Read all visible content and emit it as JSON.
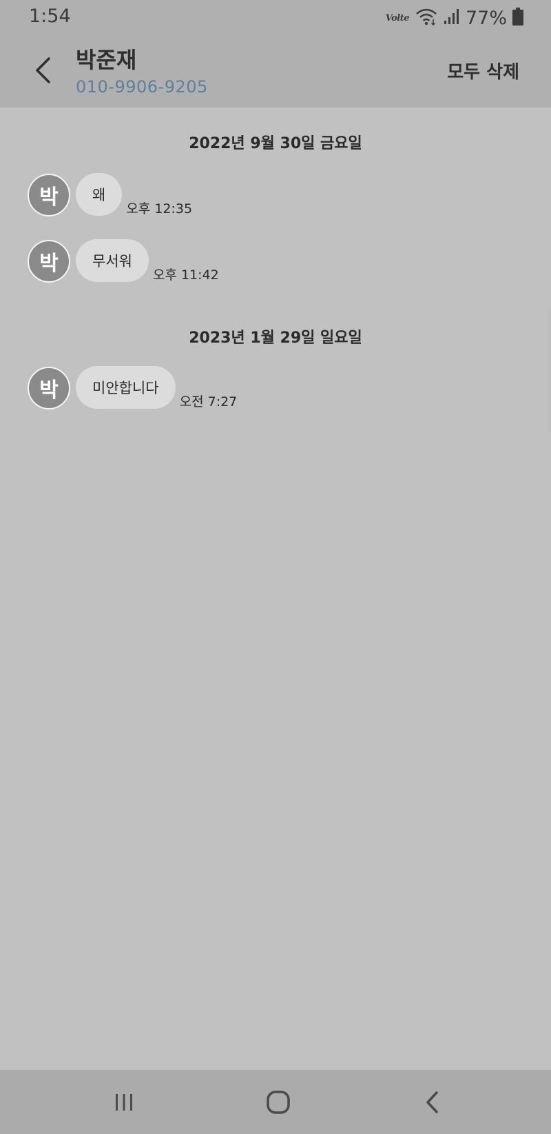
{
  "status_bar": {
    "time": "1:54",
    "volte_label": "Volte",
    "battery_percent": "77%",
    "icons": [
      "volte-icon",
      "wifi-icon",
      "signal-icon",
      "battery-icon"
    ]
  },
  "header": {
    "contact_name": "박준재",
    "phone_number": "010-9906-9205",
    "delete_all_label": "모두 삭제",
    "back_icon": "back-arrow-icon"
  },
  "conversation": {
    "groups": [
      {
        "date": "2022년 9월 30일 금요일",
        "messages": [
          {
            "avatar_initial": "박",
            "text": "왜",
            "time": "오후 12:35"
          },
          {
            "avatar_initial": "박",
            "text": "무서워",
            "time": "오후 11:42"
          }
        ]
      },
      {
        "date": "2023년 1월 29일 일요일",
        "messages": [
          {
            "avatar_initial": "박",
            "text": "미안합니다",
            "time": "오전 7:27"
          }
        ]
      }
    ]
  },
  "nav_bar": {
    "icons": [
      "recent-apps-icon",
      "home-icon",
      "back-icon"
    ]
  },
  "colors": {
    "background": "#c1c1c1",
    "header_background": "#b0b0b0",
    "phone_number": "#5d7f9c",
    "bubble": "#dcdcdc",
    "avatar": "#8a8a8a"
  }
}
